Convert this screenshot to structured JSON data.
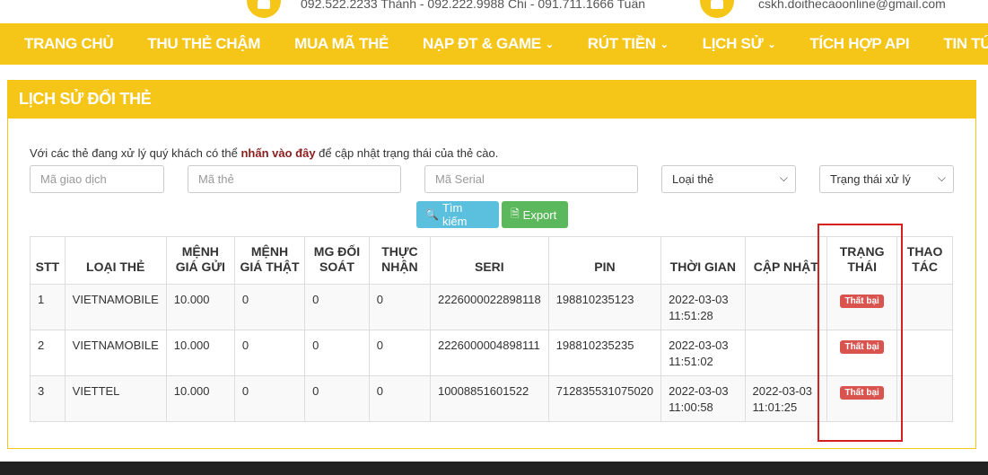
{
  "contact": {
    "phones": "092.522.2233 Thành - 092.222.9988 Chi - 091.711.1666 Tuấn",
    "email": "cskh.doithecaoonline@gmail.com"
  },
  "nav": {
    "items": [
      {
        "label": "TRANG CHỦ",
        "dropdown": false
      },
      {
        "label": "THU THẺ CHẬM",
        "dropdown": false
      },
      {
        "label": "MUA MÃ THẺ",
        "dropdown": false
      },
      {
        "label": "NẠP ĐT & GAME",
        "dropdown": true
      },
      {
        "label": "RÚT TIỀN",
        "dropdown": true
      },
      {
        "label": "LỊCH SỬ",
        "dropdown": true
      },
      {
        "label": "TÍCH HỢP API",
        "dropdown": false
      },
      {
        "label": "TIN TỨC",
        "dropdown": false
      }
    ]
  },
  "panel": {
    "title": "LỊCH SỬ ĐỔI THẺ",
    "hint_before": "Với các thẻ đang xử lý quý khách có thể ",
    "hint_link": "nhấn vào đây",
    "hint_after": " để cập nhật trạng thái của thẻ cào."
  },
  "filters": {
    "transaction_placeholder": "Mã giao dịch",
    "code_placeholder": "Mã thẻ",
    "serial_placeholder": "Mã Serial",
    "card_type": "Loại thẻ",
    "status": "Trạng thái xử lý"
  },
  "actions": {
    "search": "Tìm kiếm",
    "export": "Export"
  },
  "table": {
    "headers": [
      "STT",
      "LOẠI THẺ",
      "MỆNH GIÁ GỬI",
      "MỆNH GIÁ THẬT",
      "MG ĐỐI SOÁT",
      "THỰC NHẬN",
      "SERI",
      "PIN",
      "THỜI GIAN",
      "CẬP NHẬT",
      "TRẠNG THÁI",
      "THAO TÁC"
    ],
    "rows": [
      {
        "stt": "1",
        "type": "VIETNAMOBILE",
        "sent": "10.000",
        "real": "0",
        "mg": "0",
        "received": "0",
        "serial": "2226000022898118",
        "pin": "198810235123",
        "time_date": "2022-03-03",
        "time_clock": "11:51:28",
        "upd_date": "",
        "upd_clock": "",
        "status": "Thất bại"
      },
      {
        "stt": "2",
        "type": "VIETNAMOBILE",
        "sent": "10.000",
        "real": "0",
        "mg": "0",
        "received": "0",
        "serial": "2226000004898111",
        "pin": "198810235235",
        "time_date": "2022-03-03",
        "time_clock": "11:51:02",
        "upd_date": "",
        "upd_clock": "",
        "status": "Thất bại"
      },
      {
        "stt": "3",
        "type": "VIETTEL",
        "sent": "10.000",
        "real": "0",
        "mg": "0",
        "received": "0",
        "serial": "10008851601522",
        "pin": "712835531075020",
        "time_date": "2022-03-03",
        "time_clock": "11:00:58",
        "upd_date": "2022-03-03",
        "upd_clock": "11:01:25",
        "status": "Thất bại"
      }
    ]
  },
  "colors": {
    "accent": "#f5c518",
    "danger": "#d9534f",
    "info": "#5bc0de",
    "success": "#5cb85c",
    "highlight": "#d62020"
  }
}
